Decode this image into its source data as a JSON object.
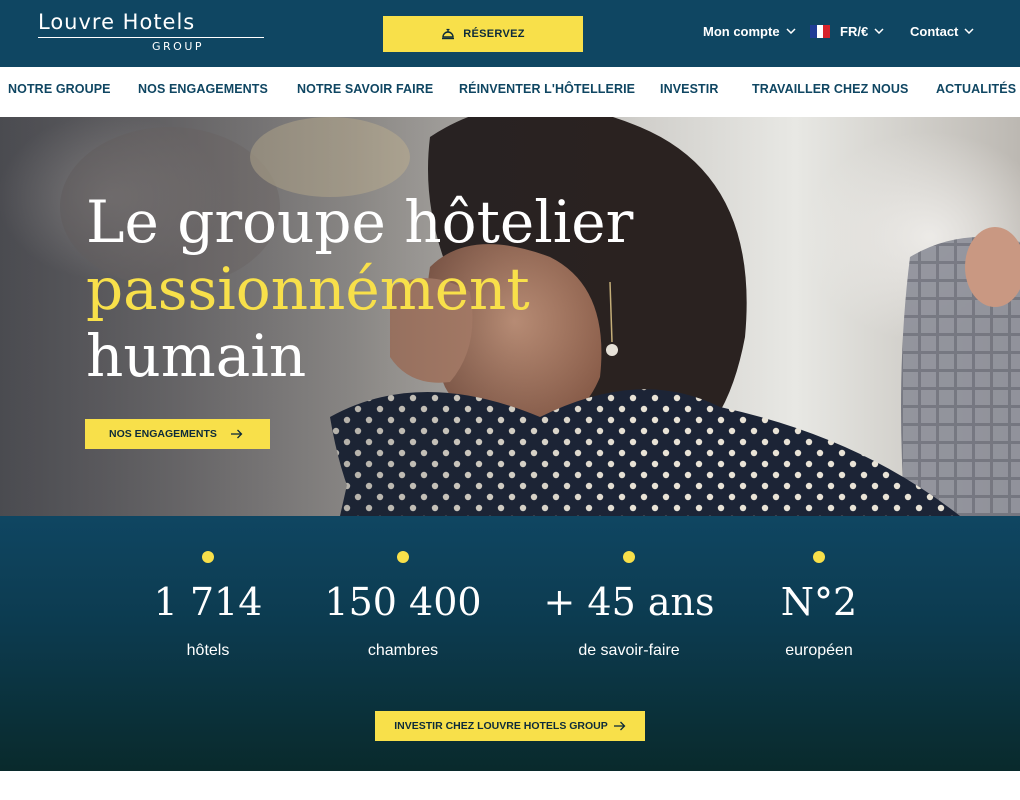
{
  "brand": {
    "logo_main": "Louvre Hotels",
    "logo_sub": "GROUP"
  },
  "header": {
    "reserve_label": "RÉSERVEZ",
    "account_label": "Mon compte",
    "language_label": "FR/€",
    "contact_label": "Contact"
  },
  "nav": {
    "items": [
      {
        "label": "NOTRE GROUPE"
      },
      {
        "label": "NOS ENGAGEMENTS"
      },
      {
        "label": "NOTRE SAVOIR FAIRE"
      },
      {
        "label": "RÉINVENTER L'HÔTELLERIE"
      },
      {
        "label": "INVESTIR"
      },
      {
        "label": "TRAVAILLER CHEZ NOUS"
      },
      {
        "label": "ACTUALITÉS"
      }
    ]
  },
  "hero": {
    "line1": "Le groupe hôtelier",
    "line2": "passionnément",
    "line3": "humain",
    "cta_label": "NOS ENGAGEMENTS"
  },
  "stats": {
    "items": [
      {
        "value": "1 714",
        "label": "hôtels"
      },
      {
        "value": "150 400",
        "label": "chambres"
      },
      {
        "value": "+ 45 ans",
        "label": "de savoir-faire"
      },
      {
        "value": "N°2",
        "label": "européen"
      }
    ],
    "cta_label": "INVESTIR CHEZ LOUVRE HOTELS GROUP"
  },
  "colors": {
    "primary": "#0f4662",
    "accent": "#f8e04a",
    "text_on_accent": "#0d2b3a"
  },
  "icons": {
    "reserve": "bell-icon",
    "dropdown": "chevron-down-icon",
    "language": "flag-fr-icon",
    "cta": "arrow-right-icon"
  }
}
